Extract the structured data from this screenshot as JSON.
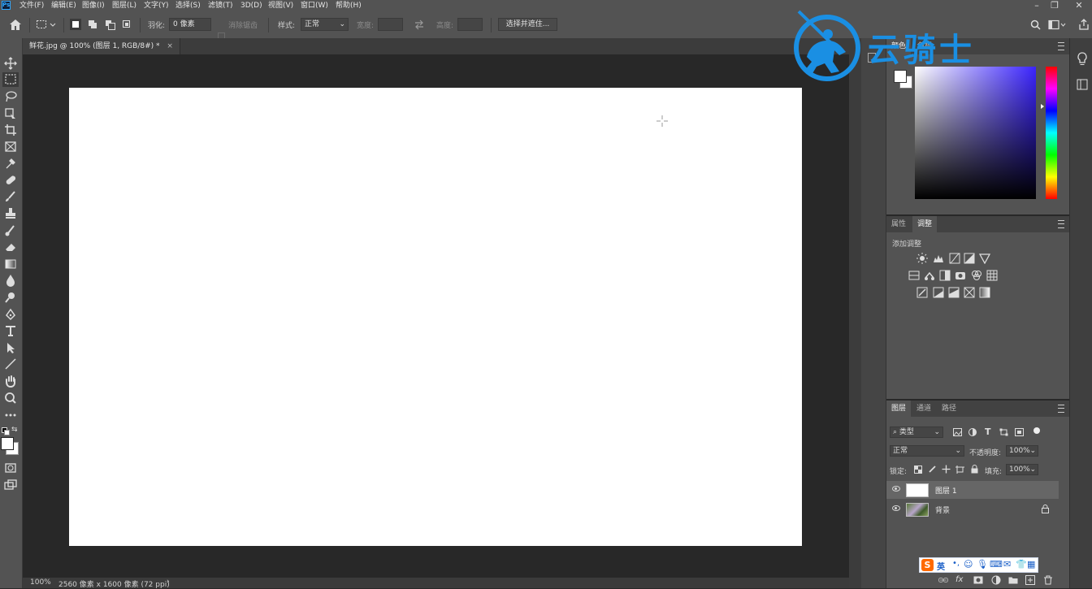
{
  "app": {
    "logo_text": "Ps",
    "menus": [
      "文件(F)",
      "编辑(E)",
      "图像(I)",
      "图层(L)",
      "文字(Y)",
      "选择(S)",
      "滤镜(T)",
      "3D(D)",
      "视图(V)",
      "窗口(W)",
      "帮助(H)"
    ]
  },
  "options": {
    "feather_label": "羽化:",
    "feather_value": "0 像素",
    "antialias_label": "消除锯齿",
    "style_label": "样式:",
    "style_value": "正常",
    "width_label": "宽度:",
    "height_label": "高度:",
    "select_mask_button": "选择并遮住..."
  },
  "document": {
    "tab_title": "鲜花.jpg @ 100% (图层 1, RGB/8#) *",
    "tab_close": "×",
    "zoom": "100%",
    "status_info": "2560 像素 x 1600 像素 (72 ppi)",
    "status_arrow": "›"
  },
  "watermark": {
    "text": "云骑士",
    "color": "#1a8fe3"
  },
  "panels": {
    "color_tabs": [
      "颜色",
      "色板"
    ],
    "adjust_tabs": [
      "属性",
      "调整"
    ],
    "adjust_add_label": "添加调整",
    "layers_tabs": [
      "图层",
      "通道",
      "路径"
    ],
    "layers_filter": "类型",
    "blend_mode": "正常",
    "opacity_label": "不透明度:",
    "opacity_value": "100%",
    "lock_label": "锁定:",
    "fill_label": "填充:",
    "fill_value": "100%",
    "layers": [
      {
        "name": "图层 1",
        "selected": true,
        "locked": false
      },
      {
        "name": "背景",
        "selected": false,
        "locked": true
      }
    ]
  },
  "ime": {
    "logo": "S",
    "lang": "英"
  },
  "colors": {
    "ui_dark": "#535353",
    "workspace": "#282828",
    "accent": "#31a8ff"
  }
}
